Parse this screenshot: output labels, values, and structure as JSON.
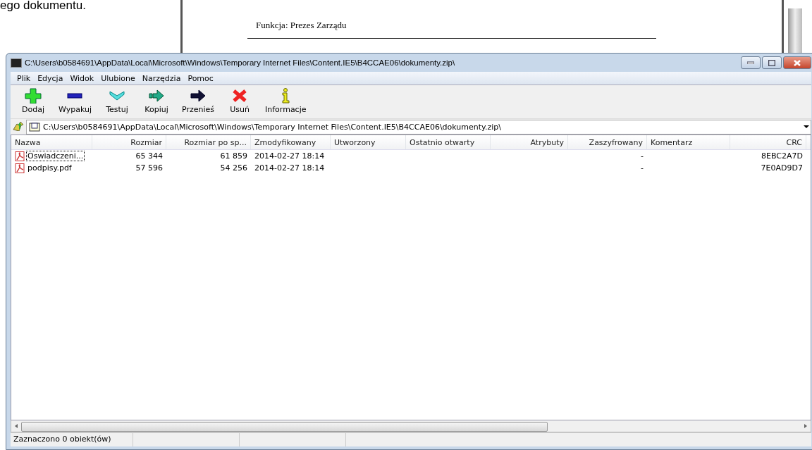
{
  "background_document": {
    "caption": "ego dokumentu.",
    "lines": [
      "Funkcja: Prezes Zarządu"
    ]
  },
  "window": {
    "title": "C:\\Users\\b0584691\\AppData\\Local\\Microsoft\\Windows\\Temporary Internet Files\\Content.IE5\\B4CCAE06\\dokumenty.zip\\"
  },
  "menu": [
    "Plik",
    "Edycja",
    "Widok",
    "Ulubione",
    "Narzędzia",
    "Pomoc"
  ],
  "toolbar": [
    {
      "kind": "add",
      "label": "Dodaj"
    },
    {
      "kind": "extract",
      "label": "Wypakuj"
    },
    {
      "kind": "test",
      "label": "Testuj"
    },
    {
      "kind": "copy",
      "label": "Kopiuj"
    },
    {
      "kind": "move",
      "label": "Przenieś"
    },
    {
      "kind": "delete",
      "label": "Usuń"
    },
    {
      "kind": "info",
      "label": "Informacje"
    }
  ],
  "address": {
    "value": "C:\\Users\\b0584691\\AppData\\Local\\Microsoft\\Windows\\Temporary Internet Files\\Content.IE5\\B4CCAE06\\dokumenty.zip\\"
  },
  "table": {
    "columns": [
      "Nazwa",
      "Rozmiar",
      "Rozmiar po sp...",
      "Zmodyfikowany",
      "Utworzony",
      "Ostatnio otwarty",
      "Atrybuty",
      "Zaszyfrowany",
      "Komentarz",
      "CRC"
    ],
    "rows": [
      {
        "focused": true,
        "cells": [
          "Oswiadczeni...",
          "65 344",
          "61 859",
          "2014-02-27 18:14",
          "",
          "",
          "",
          "-",
          "",
          "8EBC2A7D"
        ]
      },
      {
        "focused": false,
        "cells": [
          "podpisy.pdf",
          "57 596",
          "54 256",
          "2014-02-27 18:14",
          "",
          "",
          "",
          "-",
          "",
          "7E0AD9D7"
        ]
      }
    ]
  },
  "status_bar": "Zaznaczono 0 obiekt(ów)"
}
